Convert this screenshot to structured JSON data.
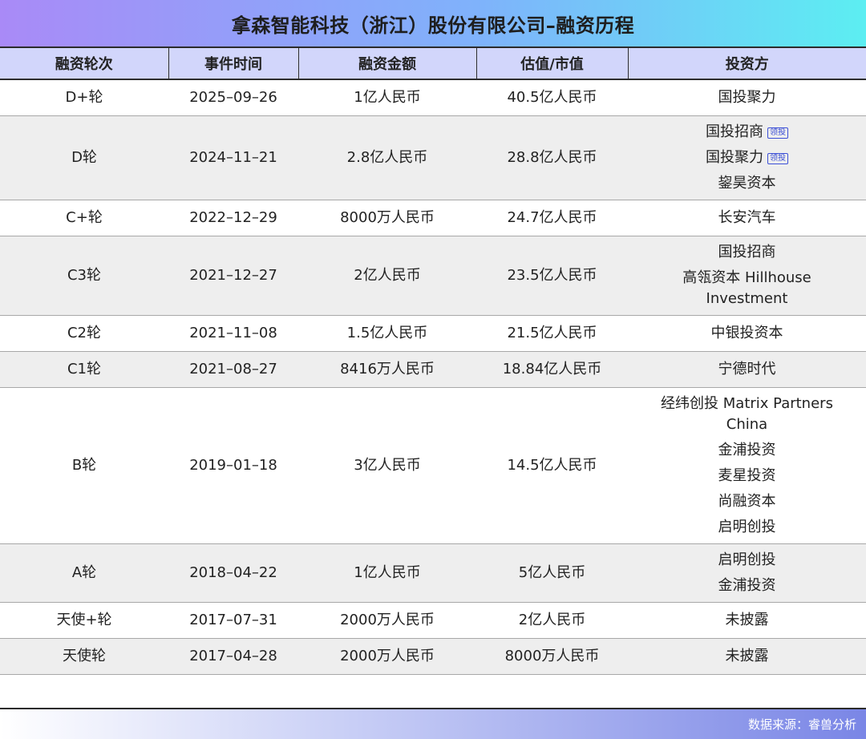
{
  "title": "拿森智能科技（浙江）股份有限公司–融资历程",
  "columns": [
    "融资轮次",
    "事件时间",
    "融资金额",
    "估值/市值",
    "投资方"
  ],
  "lead_tag": "领投",
  "rows": [
    {
      "round": "D+轮",
      "date": "2025–09–26",
      "amount": "1亿人民币",
      "valuation": "40.5亿人民币",
      "investors": [
        {
          "name": "国投聚力",
          "lead": false
        }
      ]
    },
    {
      "round": "D轮",
      "date": "2024–11–21",
      "amount": "2.8亿人民币",
      "valuation": "28.8亿人民币",
      "investors": [
        {
          "name": "国投招商",
          "lead": true
        },
        {
          "name": "国投聚力",
          "lead": true
        },
        {
          "name": "鋆昊资本",
          "lead": false
        }
      ]
    },
    {
      "round": "C+轮",
      "date": "2022–12–29",
      "amount": "8000万人民币",
      "valuation": "24.7亿人民币",
      "investors": [
        {
          "name": "长安汽车",
          "lead": false
        }
      ]
    },
    {
      "round": "C3轮",
      "date": "2021–12–27",
      "amount": "2亿人民币",
      "valuation": "23.5亿人民币",
      "investors": [
        {
          "name": "国投招商",
          "lead": false
        },
        {
          "name": "高瓴资本 Hillhouse Investment",
          "lead": false
        }
      ]
    },
    {
      "round": "C2轮",
      "date": "2021–11–08",
      "amount": "1.5亿人民币",
      "valuation": "21.5亿人民币",
      "investors": [
        {
          "name": "中银投资本",
          "lead": false
        }
      ]
    },
    {
      "round": "C1轮",
      "date": "2021–08–27",
      "amount": "8416万人民币",
      "valuation": "18.84亿人民币",
      "investors": [
        {
          "name": "宁德时代",
          "lead": false
        }
      ]
    },
    {
      "round": "B轮",
      "date": "2019–01–18",
      "amount": "3亿人民币",
      "valuation": "14.5亿人民币",
      "investors": [
        {
          "name": "经纬创投 Matrix Partners China",
          "lead": false
        },
        {
          "name": "金浦投资",
          "lead": false
        },
        {
          "name": "麦星投资",
          "lead": false
        },
        {
          "name": "尚融资本",
          "lead": false
        },
        {
          "name": "启明创投",
          "lead": false
        }
      ]
    },
    {
      "round": "A轮",
      "date": "2018–04–22",
      "amount": "1亿人民币",
      "valuation": "5亿人民币",
      "investors": [
        {
          "name": "启明创投",
          "lead": false
        },
        {
          "name": "金浦投资",
          "lead": false
        }
      ]
    },
    {
      "round": "天使+轮",
      "date": "2017–07–31",
      "amount": "2000万人民币",
      "valuation": "2亿人民币",
      "investors": [
        {
          "name": "未披露",
          "lead": false
        }
      ]
    },
    {
      "round": "天使轮",
      "date": "2017–04–28",
      "amount": "2000万人民币",
      "valuation": "8000万人民币",
      "investors": [
        {
          "name": "未披露",
          "lead": false
        }
      ]
    }
  ],
  "footer": "数据来源：睿兽分析"
}
